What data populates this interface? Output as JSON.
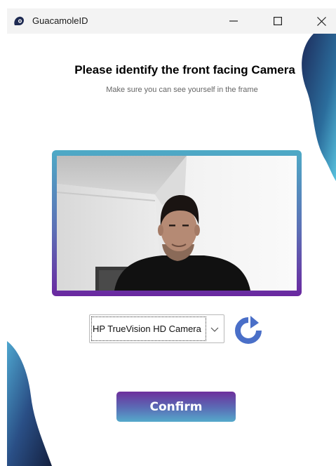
{
  "window": {
    "title": "GuacamoleID",
    "controls": [
      "minimize",
      "maximize",
      "close"
    ]
  },
  "content": {
    "heading": "Please identify the front facing Camera",
    "subheading": "Make sure you can see yourself in the frame"
  },
  "camera": {
    "selected": "HP TrueVision HD Camera"
  },
  "actions": {
    "confirm_label": "Confirm"
  },
  "colors": {
    "accent_purple": "#6a28a0",
    "accent_blue": "#4eaac6",
    "refresh_blue": "#4a6fc8",
    "blob_dark": "#1d2c5c"
  },
  "icons": {
    "app": "guacamole-logo-icon",
    "minimize": "minimize-icon",
    "maximize": "maximize-icon",
    "close": "close-icon",
    "dropdown": "chevron-down-icon",
    "refresh": "refresh-icon"
  }
}
